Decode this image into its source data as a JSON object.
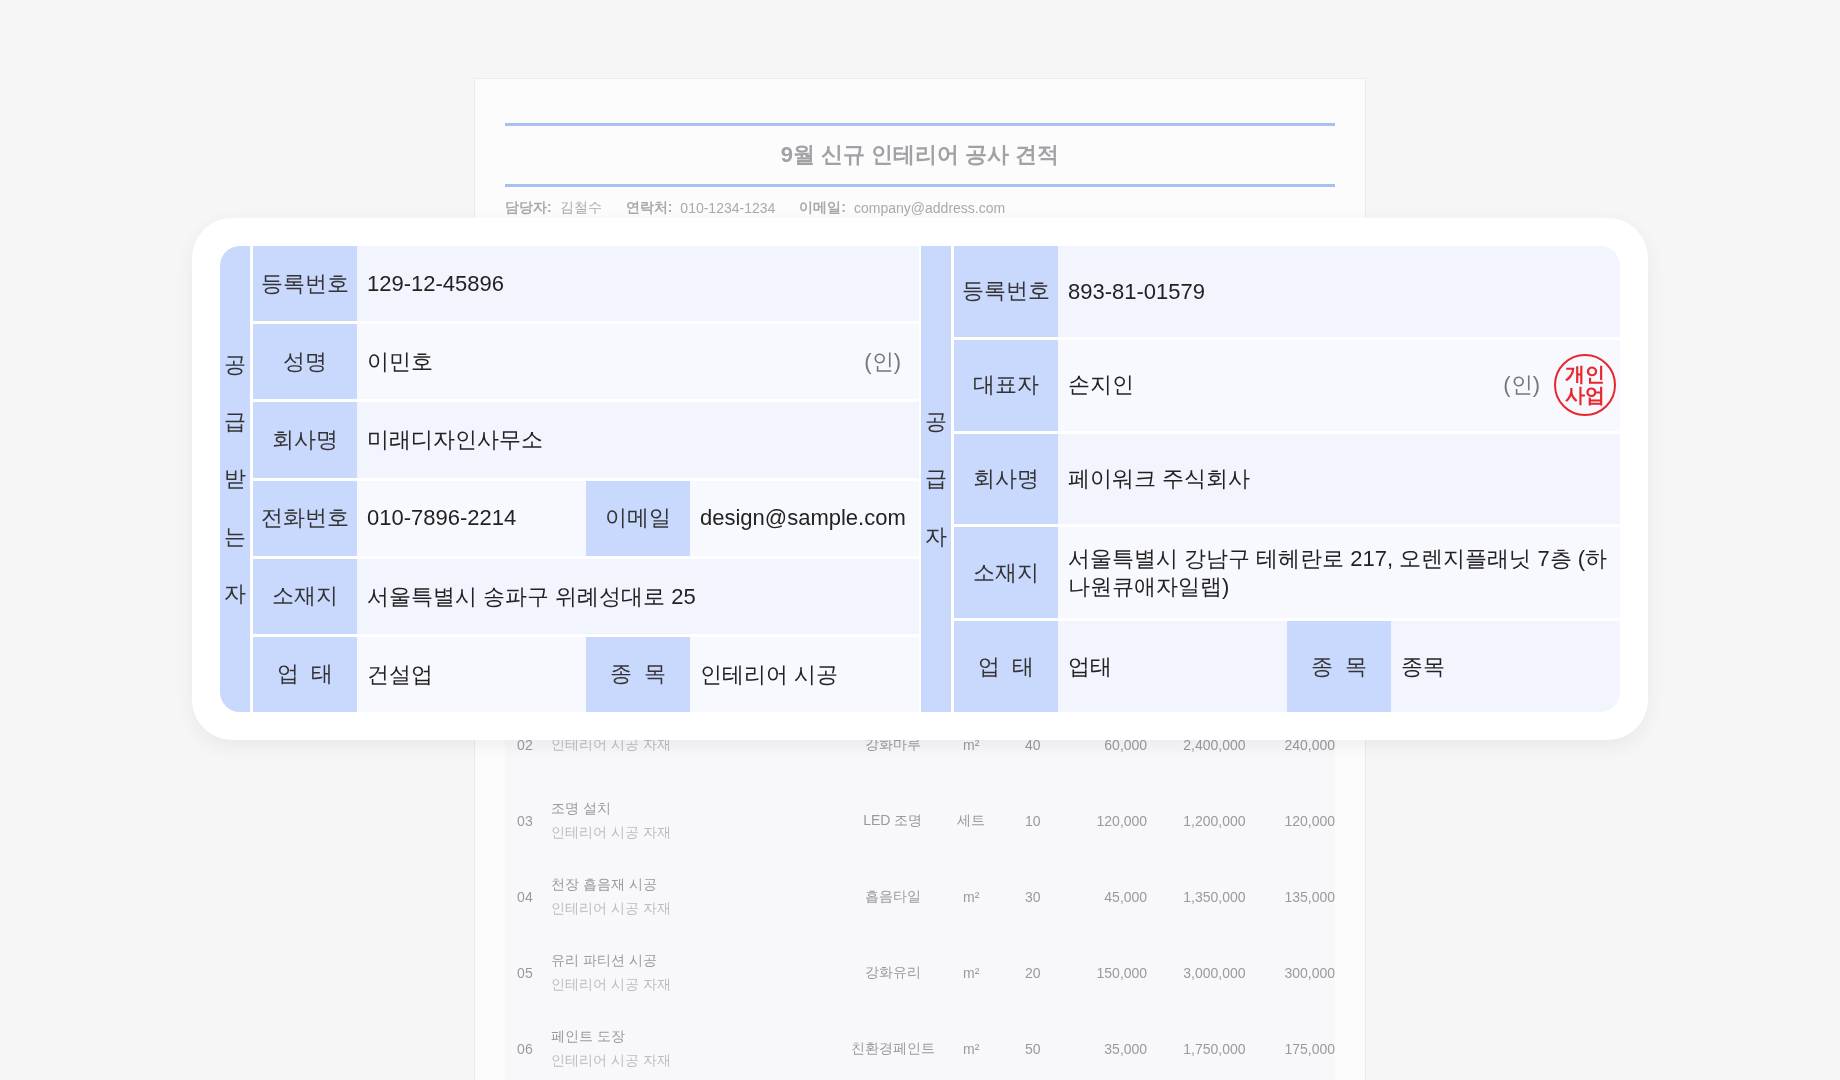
{
  "document": {
    "title": "9월 신규 인테리어 공사 견적",
    "meta": [
      {
        "label": "담당자:",
        "value": "김철수"
      },
      {
        "label": "연락처:",
        "value": "010-1234-1234"
      },
      {
        "label": "이메일:",
        "value": "company@address.com"
      }
    ],
    "rows": [
      {
        "no": "02",
        "sub": "인테리어 시공 자재",
        "spec": "강화마루",
        "unit": "m²",
        "qty": "40",
        "price": "60,000",
        "amount": "2,400,000",
        "tax": "240,000"
      },
      {
        "no": "03",
        "name": "조명 설치",
        "sub": "인테리어 시공 자재",
        "spec": "LED 조명",
        "unit": "세트",
        "qty": "10",
        "price": "120,000",
        "amount": "1,200,000",
        "tax": "120,000"
      },
      {
        "no": "04",
        "name": "천장 흡음재 시공",
        "sub": "인테리어 시공 자재",
        "spec": "흡음타일",
        "unit": "m²",
        "qty": "30",
        "price": "45,000",
        "amount": "1,350,000",
        "tax": "135,000"
      },
      {
        "no": "05",
        "name": "유리 파티션 시공",
        "sub": "인테리어 시공 자재",
        "spec": "강화유리",
        "unit": "m²",
        "qty": "20",
        "price": "150,000",
        "amount": "3,000,000",
        "tax": "300,000"
      },
      {
        "no": "06",
        "name": "페인트 도장",
        "sub": "인테리어 시공 자재",
        "spec": "친환경페인트",
        "unit": "m²",
        "qty": "50",
        "price": "35,000",
        "amount": "1,750,000",
        "tax": "175,000"
      }
    ]
  },
  "receiver": {
    "side_label": "공급받는자",
    "rows": [
      {
        "cells": [
          {
            "label": "등록번호",
            "value": "129-12-45896"
          }
        ]
      },
      {
        "cells": [
          {
            "label": "성명",
            "value": "이민호",
            "seal": "(인)"
          }
        ]
      },
      {
        "cells": [
          {
            "label": "회사명",
            "value": "미래디자인사무소"
          }
        ]
      },
      {
        "cells": [
          {
            "label": "전화번호",
            "value": "010-7896-2214"
          },
          {
            "label": "이메일",
            "value": "design@sample.com"
          }
        ]
      },
      {
        "cells": [
          {
            "label": "소재지",
            "value": "서울특별시 송파구 위례성대로 25"
          }
        ]
      },
      {
        "cells": [
          {
            "label": "업  태",
            "value": "건설업"
          },
          {
            "label": "종  목",
            "value": "인테리어 시공"
          }
        ]
      }
    ]
  },
  "supplier": {
    "side_label": "공급자",
    "rows": [
      {
        "cells": [
          {
            "label": "등록번호",
            "value": "893-81-01579"
          }
        ]
      },
      {
        "cells": [
          {
            "label": "대표자",
            "value": "손지인",
            "seal": "(인)",
            "stamp": [
              "개인",
              "사업"
            ]
          }
        ]
      },
      {
        "cells": [
          {
            "label": "회사명",
            "value": "페이워크 주식회사"
          }
        ]
      },
      {
        "cells": [
          {
            "label": "소재지",
            "value": "서울특별시 강남구 테헤란로 217, 오렌지플래닛 7층 (하나원큐애자일랩)"
          }
        ]
      },
      {
        "cells": [
          {
            "label": "업  태",
            "value": "업태"
          },
          {
            "label": "종  목",
            "value": "종목"
          }
        ]
      }
    ]
  }
}
